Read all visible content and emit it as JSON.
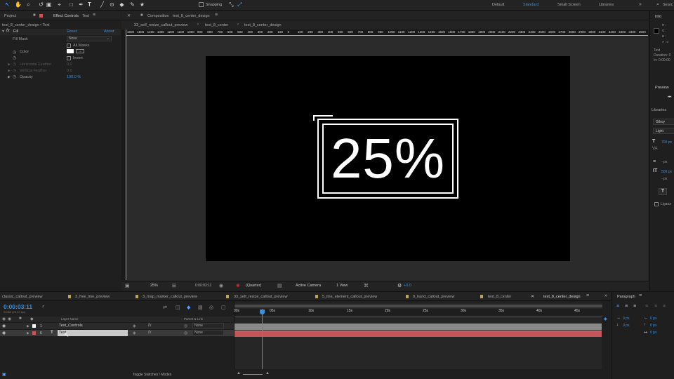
{
  "toolbar": {
    "snapping": "Snapping",
    "workspaces": [
      "Default",
      "Standard",
      "Small Screen",
      "Libraries"
    ],
    "search": "Searc"
  },
  "left_panel": {
    "tab_project": "Project",
    "tab_effect_controls": "Effect Controls",
    "tab_effect_target": "Text",
    "comp_path": "text_8_center_design • Text",
    "effect_name": "Fill",
    "reset": "Reset",
    "about": "About",
    "fill_mask_label": "Fill Mask",
    "fill_mask_value": "None",
    "all_masks": "All Masks",
    "color_label": "Color",
    "invert": "Invert",
    "horizontal_feather": "Horizontal Feather",
    "vertical_feather": "Vertical Feather",
    "feather_value_h": "0.0",
    "feather_value_v": "0.0",
    "opacity_label": "Opacity",
    "opacity_value": "100.0 %"
  },
  "composition": {
    "tab_prefix": "Composition",
    "tab_name": "text_8_center_design",
    "breadcrumbs": [
      "33_self_resize_callout_preview",
      "text_8_center",
      "text_8_center_design"
    ],
    "ruler_labels": [
      "1600",
      "1500",
      "1400",
      "1300",
      "1200",
      "1100",
      "1000",
      "900",
      "800",
      "700",
      "600",
      "500",
      "400",
      "300",
      "200",
      "100",
      "0",
      "100",
      "200",
      "300",
      "400",
      "500",
      "600",
      "700",
      "800",
      "900",
      "1000",
      "1100",
      "1200",
      "1300",
      "1400",
      "1500",
      "1600",
      "1700",
      "1800",
      "1900",
      "2000",
      "2100",
      "2200",
      "2300",
      "2400",
      "2500",
      "2600",
      "2700",
      "2800",
      "2900",
      "3000",
      "3100",
      "3200",
      "3300",
      "3400",
      "3500"
    ],
    "canvas_text": "25%",
    "zoom": "25%",
    "timecode": "0:00:03:11",
    "resolution": "(Quarter)",
    "camera": "Active Camera",
    "views": "1 View",
    "exposure": "+0.0"
  },
  "right_panel": {
    "info": "Info",
    "rgba": [
      "R :",
      "G :",
      "B :",
      "A : 0"
    ],
    "info_lines": [
      "Text",
      "Duration: 0",
      "In: 0:00:00"
    ],
    "preview": "Preview",
    "libraries": "Libraries",
    "font": "Gilroy",
    "style": "Light",
    "font_size": "700 px",
    "tracking": "500 px",
    "px": "- px",
    "px2": "- px",
    "ligatures": "Ligatur"
  },
  "timeline": {
    "tabs": [
      "classic_callout_preview",
      "3_free_line_preview",
      "3_map_marker_callout_preview",
      "33_self_resize_callout_preview",
      "5_line_element_callout_preview",
      "9_hand_callout_preview",
      "text_8_center",
      "text_8_center_design"
    ],
    "timecode": "0:00:03:11",
    "fps": "00083 (25.00 fps)",
    "col_layer_name": "Layer Name",
    "col_parent": "Parent & Link",
    "layers": [
      {
        "num": "1",
        "name": "Text_Controls",
        "parent": "None"
      },
      {
        "num": "6",
        "name": "Text",
        "parent": "None"
      }
    ],
    "time_labels": [
      "00s",
      "05s",
      "10s",
      "15s",
      "20s",
      "25s",
      "30s",
      "35s",
      "40s",
      "45s"
    ],
    "toggle": "Toggle Switches / Modes"
  },
  "paragraph": {
    "title": "Paragraph",
    "px_values": [
      "0 px",
      "0 px",
      "0 px",
      "0 px",
      "0 px"
    ]
  },
  "colors": {
    "accent": "#3d8fdc",
    "layer_text_bar": "#c4555b",
    "layer_controls_bar": "#888888",
    "canvas": "#000000"
  }
}
